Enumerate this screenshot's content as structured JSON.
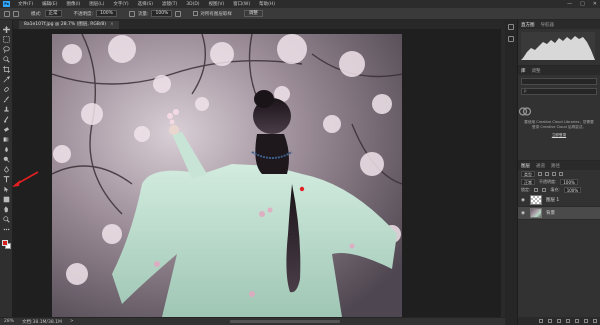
{
  "app": {
    "logo_text": "Ps"
  },
  "menubar": {
    "items": [
      "文件(F)",
      "编辑(E)",
      "图像(I)",
      "图层(L)",
      "文字(Y)",
      "选择(S)",
      "滤镜(T)",
      "3D(D)",
      "视图(V)",
      "窗口(W)",
      "帮助(H)"
    ],
    "window_controls": [
      "—",
      "□",
      "✕"
    ]
  },
  "options_bar": {
    "mode_label": "模式:",
    "mode_value": "正常",
    "opacity_label": "不透明度:",
    "opacity_value": "100%",
    "flow_label": "流量:",
    "flow_value": "100%",
    "sample_all_layers_label": "对所有图层取样",
    "adjust_button": "调整"
  },
  "document": {
    "tab_title": "8a1e107f.jpg @ 28.7% (图层, RGB/8)",
    "close_glyph": "×"
  },
  "status_bar": {
    "zoom": "28%",
    "doc_size": "文档:38.1M/38.1M",
    "arrow": ">"
  },
  "tools": [
    "move-icon",
    "marquee-icon",
    "lasso-icon",
    "quick-select-icon",
    "crop-icon",
    "eyedropper-icon",
    "healing-brush-icon",
    "brush-icon",
    "clone-stamp-icon",
    "history-brush-icon",
    "eraser-icon",
    "gradient-icon",
    "blur-icon",
    "dodge-icon",
    "pen-icon",
    "type-icon",
    "path-select-icon",
    "shape-icon",
    "hand-icon",
    "zoom-icon",
    "more-icon"
  ],
  "colors": {
    "foreground": "#d42020",
    "background": "#ffffff",
    "annotation_arrow": "#e02020",
    "accent": "#31a8ff"
  },
  "panels": {
    "histogram": {
      "tabs": [
        "直方图",
        "导航器"
      ]
    },
    "libraries": {
      "tabs": [
        "库",
        "调整"
      ],
      "search_placeholder": "P",
      "message": "要使用 Creative Cloud Libraries，您需要登录 Creative Cloud 后再尝试。",
      "link": "立即登录"
    },
    "layers": {
      "tabs": [
        "图层",
        "通道",
        "路径"
      ],
      "kind_filter": "类型",
      "blend_mode": "正常",
      "opacity_label": "不透明度:",
      "opacity_value": "100%",
      "lock_label": "锁定:",
      "fill_label": "填充:",
      "fill_value": "100%",
      "items": [
        {
          "name": "图层 1",
          "selected": false
        },
        {
          "name": "背景",
          "selected": true
        }
      ]
    }
  },
  "image": {
    "description": "woman in light green hanfu holding blossom branch under cherry blossoms"
  }
}
